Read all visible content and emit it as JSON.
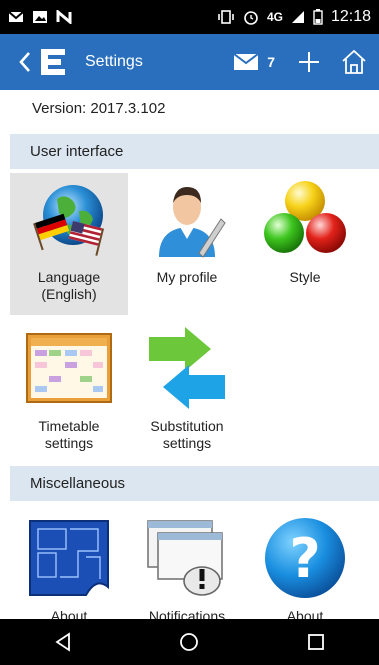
{
  "status_bar": {
    "time": "12:18",
    "network": "4G"
  },
  "header": {
    "back_icon": "chevron-left-icon",
    "app_logo_letter": "E",
    "title": "Settings",
    "message_count": "7"
  },
  "version_text": "Version: 2017.3.102",
  "sections": {
    "user_interface": "User interface",
    "miscellaneous": "Miscellaneous"
  },
  "tiles": {
    "language": {
      "line1": "Language",
      "line2": "(English)"
    },
    "my_profile": {
      "label": "My profile"
    },
    "style": {
      "label": "Style"
    },
    "timetable": {
      "line1": "Timetable",
      "line2": "settings"
    },
    "substitution": {
      "line1": "Substitution",
      "line2": "settings"
    },
    "about1": {
      "label": "About"
    },
    "notifications": {
      "label": "Notifications"
    },
    "about2": {
      "label": "About"
    }
  },
  "colors": {
    "header_bg": "#2a6fbd",
    "section_bg": "#dbe6f0",
    "selected_tile_bg": "#e3e3e3"
  }
}
